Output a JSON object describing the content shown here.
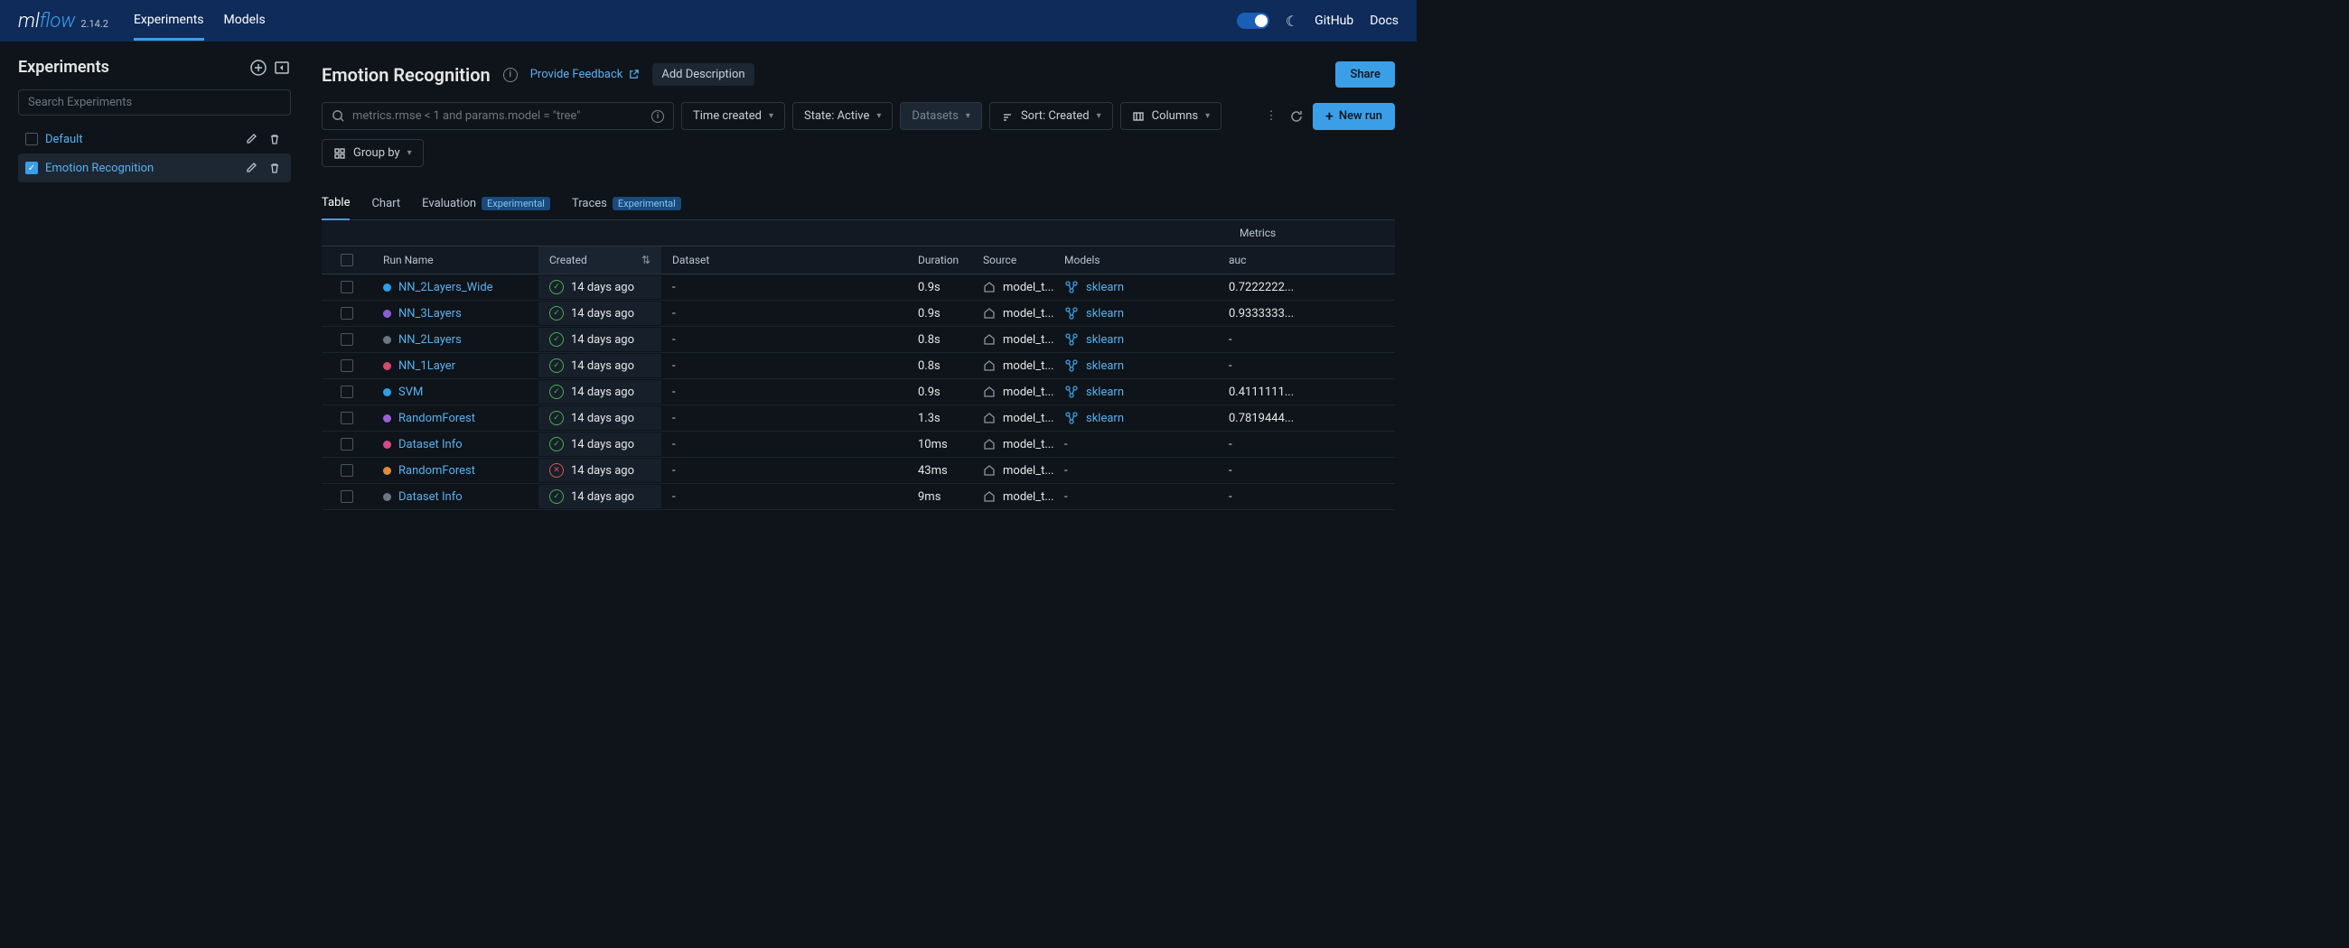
{
  "brand": {
    "ml": "ml",
    "flow": "flow",
    "version": "2.14.2"
  },
  "nav": {
    "experiments": "Experiments",
    "models": "Models"
  },
  "topright": {
    "github": "GitHub",
    "docs": "Docs"
  },
  "sidebar": {
    "title": "Experiments",
    "search_placeholder": "Search Experiments",
    "items": [
      {
        "label": "Default"
      },
      {
        "label": "Emotion Recognition"
      }
    ]
  },
  "page": {
    "title": "Emotion Recognition",
    "feedback": "Provide Feedback",
    "add_desc": "Add Description",
    "share": "Share"
  },
  "filters": {
    "query": "metrics.rmse < 1 and params.model = \"tree\"",
    "time": "Time created",
    "state": "State: Active",
    "datasets": "Datasets",
    "sort": "Sort: Created",
    "columns": "Columns",
    "groupby": "Group by",
    "newrun": "New run"
  },
  "tabs": {
    "table": "Table",
    "chart": "Chart",
    "evaluation": "Evaluation",
    "traces": "Traces",
    "exp_badge": "Experimental"
  },
  "table": {
    "section_metrics": "Metrics",
    "headers": {
      "run_name": "Run Name",
      "created": "Created",
      "dataset": "Dataset",
      "duration": "Duration",
      "source": "Source",
      "models": "Models",
      "auc": "auc"
    },
    "rows": [
      {
        "color": "#2e9ee6",
        "name": "NN_2Layers_Wide",
        "status": "ok",
        "created": "14 days ago",
        "dataset": "-",
        "duration": "0.9s",
        "source": "model_t...",
        "model": "sklearn",
        "auc": "0.7222222..."
      },
      {
        "color": "#8a5fd6",
        "name": "NN_3Layers",
        "status": "ok",
        "created": "14 days ago",
        "dataset": "-",
        "duration": "0.9s",
        "source": "model_t...",
        "model": "sklearn",
        "auc": "0.9333333..."
      },
      {
        "color": "#6b7785",
        "name": "NN_2Layers",
        "status": "ok",
        "created": "14 days ago",
        "dataset": "-",
        "duration": "0.8s",
        "source": "model_t...",
        "model": "sklearn",
        "auc": "-"
      },
      {
        "color": "#d64a6e",
        "name": "NN_1Layer",
        "status": "ok",
        "created": "14 days ago",
        "dataset": "-",
        "duration": "0.8s",
        "source": "model_t...",
        "model": "sklearn",
        "auc": "-"
      },
      {
        "color": "#2e9ee6",
        "name": "SVM",
        "status": "ok",
        "created": "14 days ago",
        "dataset": "-",
        "duration": "0.9s",
        "source": "model_t...",
        "model": "sklearn",
        "auc": "0.4111111..."
      },
      {
        "color": "#9d5fd6",
        "name": "RandomForest",
        "status": "ok",
        "created": "14 days ago",
        "dataset": "-",
        "duration": "1.3s",
        "source": "model_t...",
        "model": "sklearn",
        "auc": "0.7819444..."
      },
      {
        "color": "#d64a8a",
        "name": "Dataset Info",
        "status": "ok",
        "created": "14 days ago",
        "dataset": "-",
        "duration": "10ms",
        "source": "model_t...",
        "model": "-",
        "auc": "-"
      },
      {
        "color": "#e08a3a",
        "name": "RandomForest",
        "status": "fail",
        "created": "14 days ago",
        "dataset": "-",
        "duration": "43ms",
        "source": "model_t...",
        "model": "-",
        "auc": "-"
      },
      {
        "color": "#6b7785",
        "name": "Dataset Info",
        "status": "ok",
        "created": "14 days ago",
        "dataset": "-",
        "duration": "9ms",
        "source": "model_t...",
        "model": "-",
        "auc": "-"
      }
    ]
  }
}
